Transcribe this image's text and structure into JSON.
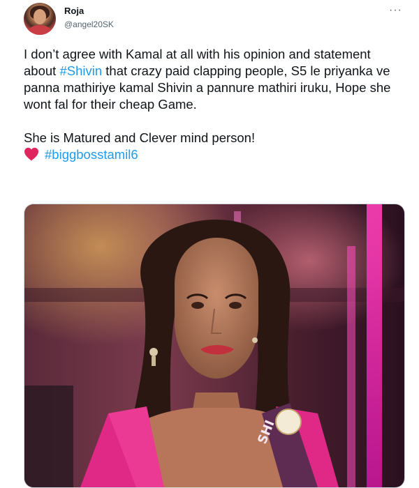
{
  "user": {
    "display_name": "Roja",
    "handle": "@angel20SK"
  },
  "menu": {
    "more_label": "···"
  },
  "tweet": {
    "line1_a": "I don’t agree with Kamal at all with his opinion and statement about ",
    "hashtag_shivin": "#Shivin",
    "line1_b": " that crazy paid clapping people, S5 le priyanka ve panna mathiriye kamal Shivin a pannure mathiri iruku, Hope she wont fal for their cheap Game.",
    "line2": "She is Matured and Clever mind person!",
    "hashtag_bb": "#biggbosstamil6"
  },
  "media": {
    "sash_text": "SHI"
  },
  "colors": {
    "hashtag": "#1d9bf0",
    "heart": "#e0245e",
    "text": "#0f1419",
    "muted": "#536471"
  }
}
